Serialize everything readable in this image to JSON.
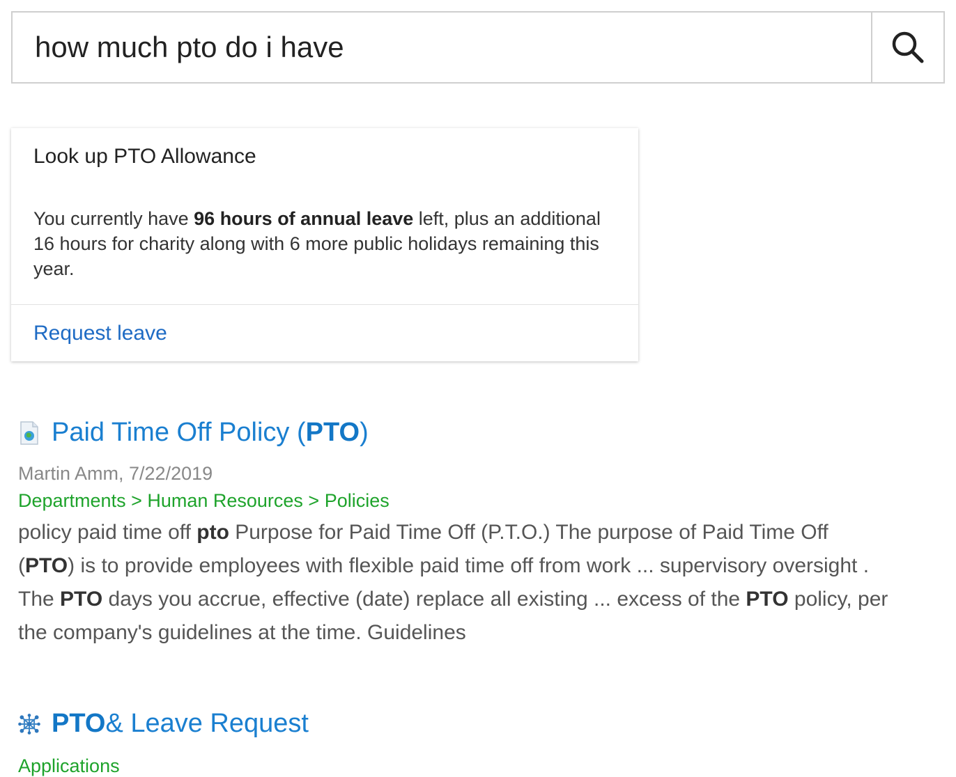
{
  "search": {
    "query": "how much pto do i have",
    "button_icon": "search-icon"
  },
  "answer_card": {
    "title": "Look up PTO Allowance",
    "body_prefix": "You currently have ",
    "body_bold": "96 hours of annual leave",
    "body_suffix": " left, plus an additional 16 hours for charity along with 6 more public holidays remaining this year.",
    "action_label": "Request leave",
    "link_color": "#1e6bc4"
  },
  "results": [
    {
      "icon": "document-globe-icon",
      "title_prefix": "Paid Time Off Policy (",
      "title_bold": "PTO",
      "title_suffix": ")",
      "meta": "Martin Amm, 7/22/2019",
      "breadcrumb": "Departments > Human Resources > Policies",
      "snippet": [
        {
          "t": "policy paid time off ",
          "b": false
        },
        {
          "t": "pto",
          "b": true
        },
        {
          "t": " Purpose for Paid Time Off (P.T.O.) The purpose of Paid Time Off (",
          "b": false
        },
        {
          "t": "PTO",
          "b": true
        },
        {
          "t": ") is to provide employees with flexible paid time off from work ... supervisory oversight . The ",
          "b": false
        },
        {
          "t": "PTO",
          "b": true
        },
        {
          "t": " days you accrue, effective (date) replace all existing ... excess of the ",
          "b": false
        },
        {
          "t": "PTO",
          "b": true
        },
        {
          "t": " policy, per the company's guidelines at the time. Guidelines",
          "b": false
        }
      ]
    },
    {
      "icon": "network-app-icon",
      "title_prefix": "",
      "title_bold": "PTO",
      "title_suffix": " & Leave Request",
      "breadcrumb": "Applications"
    }
  ],
  "colors": {
    "title_blue": "#1a7fd0",
    "breadcrumb_green": "#1ea32b",
    "meta_gray": "#888888"
  }
}
